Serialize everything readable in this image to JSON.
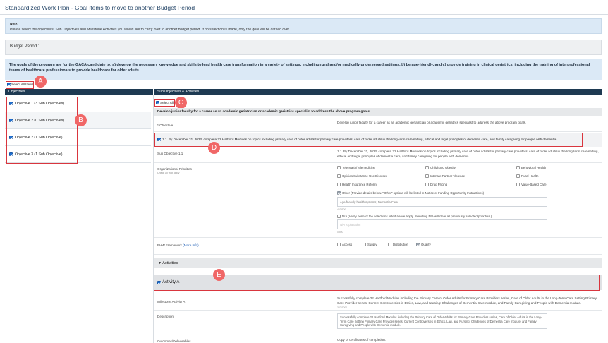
{
  "title": "Standardized Work Plan - Goal items to move to another Budget Period",
  "note": {
    "label": "Note:",
    "text": "Please select the objectives, Sub Objectives and Milestone Activities you would like to carry over to another budget period. If no selection is made, only the goal will be carried over."
  },
  "budget_period": "Budget Period 1",
  "goal_text": "The goals of the program are for the GACA candidate to: a) develop the necessary knowledge and skills to lead health care transformation in a variety of settings, including rural and/or medically underserved settings, b) be age-friendly, and c) provide training in clinical geriatrics, including the training of interprofessional teams of healthcare professionals to provide healthcare for older adults.",
  "select_all_items": "Select All Items",
  "objectives_header": "Objectives",
  "objectives": [
    "Objective 1 (3 Sub Objectives)",
    "Objective 2 (0 Sub Objectives)",
    "Objective 2 (1 Sub Objective)",
    "Objective 3 (1 Sub Objective)"
  ],
  "sub_header": "Sub Objectives & Activities",
  "select_all": "Select All",
  "objective_heading": "Develop junior faculty for a career as an academic geriatrician or academic geriatrics specialist to address the above program goals.",
  "objective_label": "* Objective",
  "objective_value": "Develop junior faculty for a career as an academic geriatrician or academic geriatrics specialist to address the above program goals.",
  "sub_objective_check_text": "1.1. By December 31, 2023, complete 22 Hartford Modules on topics including primary care of older adults for primary care providers, care of older adults in the long-term care setting, ethical and legal principles of dementia care, and family caregiving for people with dementia.",
  "sub_objective_label": "Sub Objective 1.1",
  "sub_objective_value": "1.1. By December 31, 2023, complete 22 Hartford Modules on topics including primary care of older adults for primary care providers, care of older adults in the long-term care setting, ethical and legal principles of dementia care, and family caregiving for people with dementia.",
  "org_priorities_label": "Organizational Priorities",
  "org_priorities_hint": "Check all that apply",
  "priorities": [
    "Telehealth/Telemedicine",
    "Childhood Obesity",
    "Behavioral Health",
    "Opioids/Substance Use Disorder",
    "Intimate Partner Violence",
    "Rural Health",
    "Health Insurance Reform",
    "Drug Pricing",
    "Value-Based Care"
  ],
  "other_text": "Other (Provide details below. \"Other\" options will be listed in Notice of Funding Opportunity Instructions)",
  "other_value": "Age-friendly health systems, Dementia Care",
  "other_count": "463/500",
  "na_text": "N/A (Verify none of the selections listed above apply. Selecting N/A will clear all previously selected priorities.)",
  "na_placeholder": "N/A explanation",
  "na_count": "0/500",
  "bhw_label": "BHW Framework",
  "bhw_more": "(More Info)",
  "bhw_options": [
    "Access",
    "Supply",
    "Distribution",
    "Quality"
  ],
  "activities_label": "Activities",
  "activity_a": "Activity A",
  "milestone_label": "Milestone Activity A",
  "milestone_value": "Successfully complete 22 Hartford Modules including the Primary Care of Older Adults for Primary Care Providers series, Care of Older Adults in the Long-Term Care Setting Primary Care Provider series, Current Controversies in Ethics, Law, and Nursing: Challenges of Dementia Care module, and Family Caregiving and People with Dementia module.",
  "milestone_count": "342/1000",
  "description_label": "Description",
  "description_value": "Successfully complete 22 Hartford Modules including the Primary Care of Older Adults for Primary Care Providers series, Care of Older Adults in the Long-Term Care Setting Primary Care Provider series, Current Controversies in Ethics, Law, and Nursing: Challenges of Dementia Care module, and Family Caregiving and People with Dementia module.",
  "outcome_label": "Outcomes/Deliverables",
  "outcome_value": "Copy of certificates of completion.",
  "callouts": [
    "A",
    "B",
    "C",
    "D",
    "E"
  ],
  "colors": {
    "header": "#1e3a52",
    "note_bg": "#dbe9f6",
    "highlight": "#d9363e",
    "callout": "#f06767"
  }
}
